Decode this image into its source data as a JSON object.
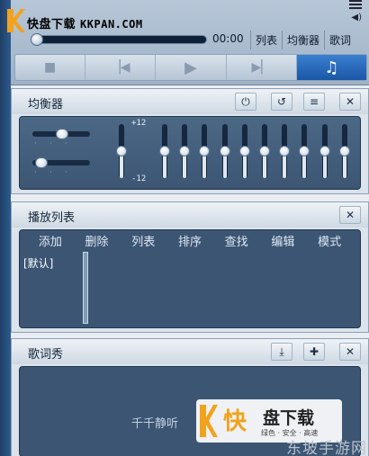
{
  "logo": {
    "name": "快盘下载",
    "url": "KKPAN.COM"
  },
  "player": {
    "time": "00:00",
    "tabs": [
      "列表",
      "均衡器",
      "歌词"
    ]
  },
  "controls": {
    "icons": [
      "stop-icon",
      "prev-icon",
      "play-icon",
      "next-icon",
      "music-note-icon"
    ],
    "active": "music-note-icon"
  },
  "equalizer": {
    "title": "均衡器",
    "plus_label": "+12",
    "minus_label": "-12",
    "balance": 0.5,
    "surround": 0.05,
    "bands": 10,
    "preamp_level": 0.5
  },
  "playlist": {
    "title": "播放列表",
    "menu": [
      "添加",
      "删除",
      "列表",
      "排序",
      "查找",
      "编辑",
      "模式"
    ],
    "lists": [
      "[默认]"
    ]
  },
  "lyrics": {
    "title": "歌词秀",
    "text": "千千静听"
  },
  "watermark": {
    "kuai": "快",
    "name": "盘下载",
    "slogan": "绿色 · 安全 · 高速",
    "site": "东坡手游网"
  },
  "colors": {
    "accent": "#1f6fd0",
    "panel_bg": "#3b5573",
    "frame": "#dbe3ec"
  }
}
